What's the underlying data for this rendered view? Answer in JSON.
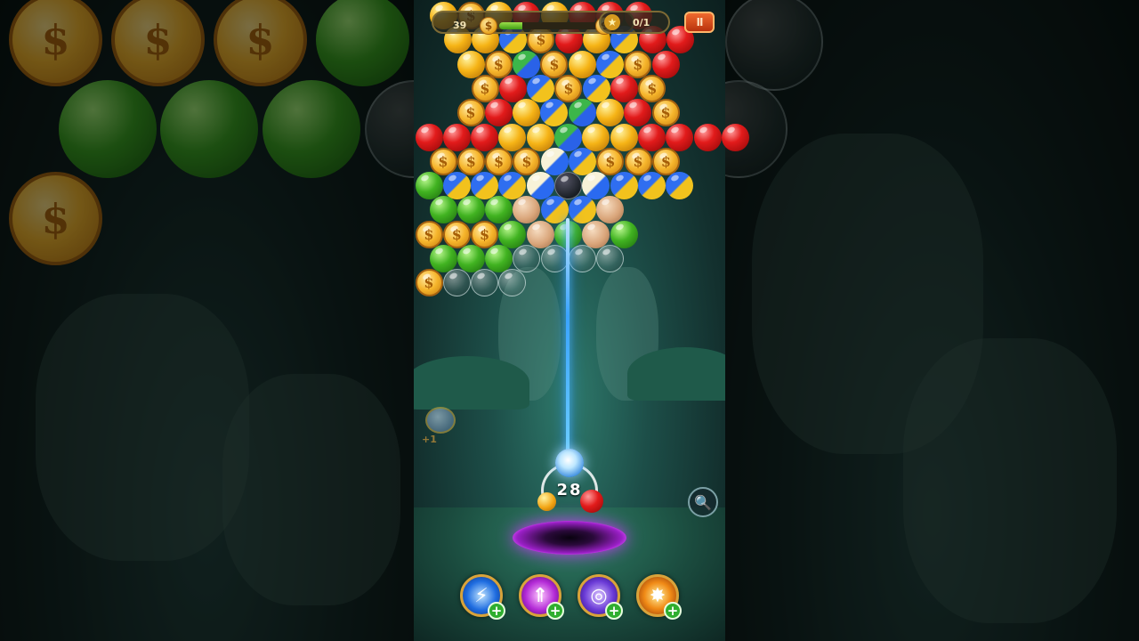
{
  "hud": {
    "score": "39",
    "progress": 0.22,
    "coin_symbol": "$",
    "goal_text": "0/1",
    "goal_icon": "star-icon",
    "pause_label": "II"
  },
  "shooter": {
    "shots_left": "28",
    "current_bubble": "lightning",
    "next_bubbles": [
      "yellow",
      "red"
    ]
  },
  "left_bonus": {
    "label": "+1",
    "icon": "bonus-pot-icon"
  },
  "zoom": {
    "icon": "magnifier-icon"
  },
  "boosters": [
    {
      "name": "lightning",
      "icon": "lightning-bubble-icon",
      "glyph": "⚡"
    },
    {
      "name": "arrow",
      "icon": "arrow-up-icon",
      "glyph": "⇑"
    },
    {
      "name": "vortex",
      "icon": "vortex-icon",
      "glyph": "◎"
    },
    {
      "name": "burst",
      "icon": "star-burst-icon",
      "glyph": "✸"
    }
  ],
  "colors": {
    "red": "#e21b1b",
    "yellow": "#f6b416",
    "green": "#41b321",
    "coin": "#f6b52b",
    "aim_line": "#3aa4ff",
    "portal": "#9a1fc6"
  },
  "board": {
    "rows": [
      "Y C Y R Y R R R",
      "Y Y M C R Y M R R",
      "Y C M C Y M C R",
      "C R M C M R C",
      "C R Y M M Y R C",
      "R R R Y Y M Y Y R R R R",
      "C C C C M3 M1 C C C",
      "G M1 M1 M1 M3 D M3 M1 M1 M1",
      "G G G S M1 M1 S",
      "C C C G S G S G",
      "G G G O O O O",
      "C O O O"
    ]
  }
}
